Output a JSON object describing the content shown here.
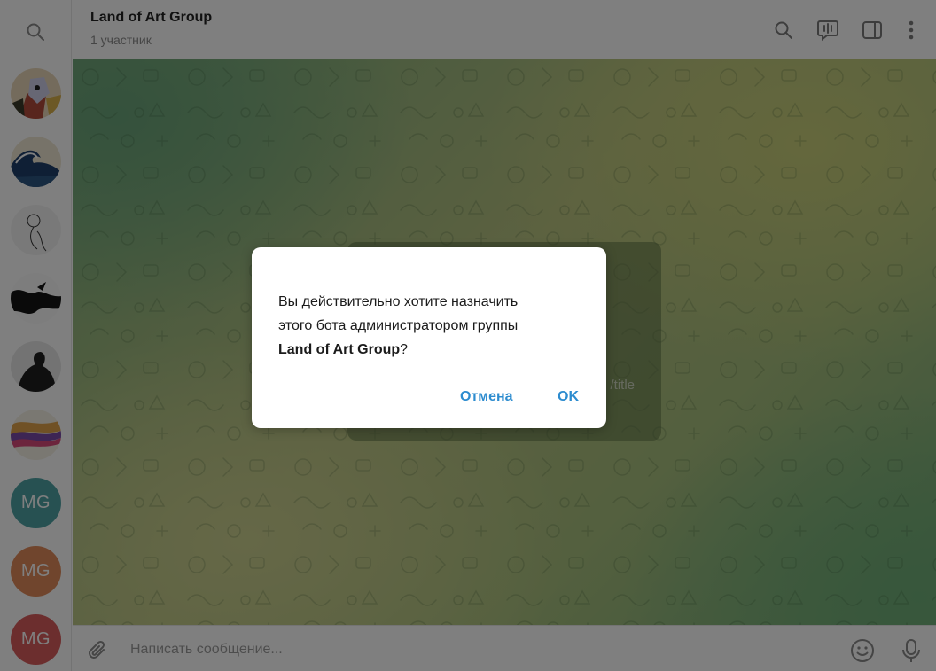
{
  "header": {
    "title": "Land of Art Group",
    "subtitle": "1 участник"
  },
  "sidebar": {
    "avatars": [
      {
        "kind": "image",
        "icon": "picasso-portrait"
      },
      {
        "kind": "image",
        "icon": "great-wave"
      },
      {
        "kind": "image",
        "icon": "line-drawing-face"
      },
      {
        "kind": "image",
        "icon": "ink-splash"
      },
      {
        "kind": "image",
        "icon": "classical-sculpture"
      },
      {
        "kind": "image",
        "icon": "colorful-brush"
      },
      {
        "kind": "initials",
        "text": "MG",
        "color": "#4fa3a5"
      },
      {
        "kind": "initials",
        "text": "MG",
        "color": "#e08a5a"
      },
      {
        "kind": "initials",
        "text": "MG",
        "color": "#d85c5c"
      }
    ]
  },
  "chat": {
    "card_fragment": "/title"
  },
  "composer": {
    "placeholder": "Написать сообщение..."
  },
  "dialog": {
    "message_line1": "Вы действительно хотите назначить",
    "message_line2": "этого бота администратором группы",
    "group_name": "Land of Art Group",
    "message_suffix": "?",
    "cancel_label": "Отмена",
    "ok_label": "OK"
  },
  "colors": {
    "accent": "#2d8ccf",
    "overlay": "rgba(0,0,0,0.5)"
  }
}
